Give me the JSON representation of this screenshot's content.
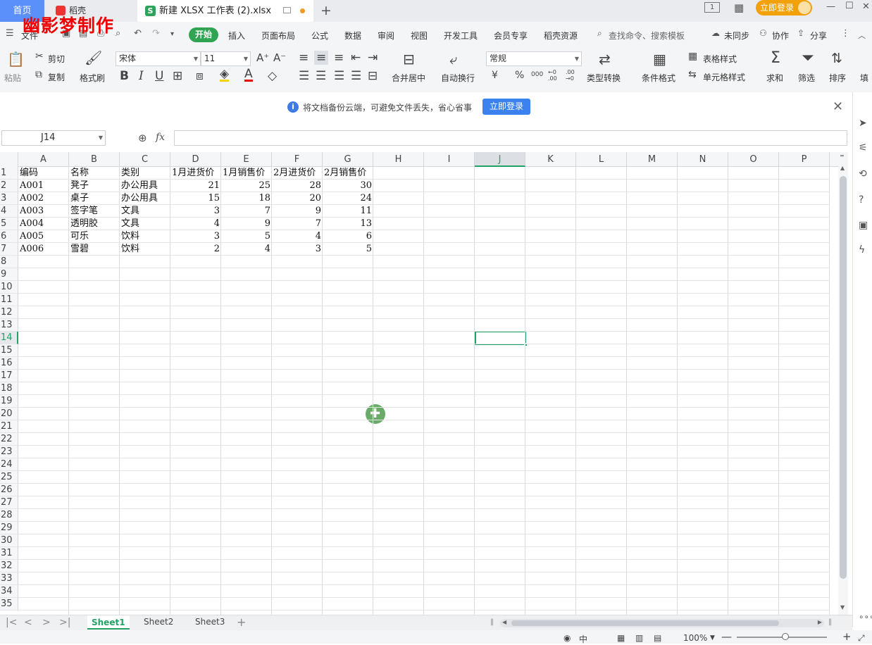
{
  "titlebar": {
    "home_tab": "首页",
    "daoke_tab": "稻壳",
    "file_tab": "新建 XLSX 工作表 (2).xlsx",
    "new_tab": "+",
    "layout_label": "1",
    "login": "立即登录",
    "minimize": "—",
    "maximize": "☐",
    "close": "✕"
  },
  "watermark": "幽影梦制作",
  "menu": {
    "file": "文件",
    "start": "开始",
    "items": [
      "插入",
      "页面布局",
      "公式",
      "数据",
      "审阅",
      "视图",
      "开发工具",
      "会员专享",
      "稻壳资源"
    ],
    "search": "查找命令、搜索模板",
    "sync": "未同步",
    "collab": "协作",
    "share": "分享"
  },
  "ribbon": {
    "paste": "粘贴",
    "cut": "剪切",
    "copy": "复制",
    "format_painter": "格式刷",
    "font_name": "宋体",
    "font_size": "11",
    "merge_center": "合并居中",
    "auto_wrap": "自动换行",
    "number_format": "常规",
    "type_convert": "类型转换",
    "conditional_format": "条件格式",
    "table_style": "表格样式",
    "cell_style": "单元格样式",
    "sum": "求和",
    "filter": "筛选",
    "sort": "排序",
    "fill": "填",
    "bold": "B",
    "italic": "I",
    "underline": "U",
    "currency": "¥",
    "percent": "%",
    "thousands": "000",
    "dec_inc": "←0 .00",
    "dec_dec": ".00 →0"
  },
  "notice": {
    "text": "将文档备份云端，可避免文件丢失，省心省事",
    "button": "立即登录"
  },
  "formula": {
    "name_box": "J14",
    "fx": "fx"
  },
  "columns": [
    "A",
    "B",
    "C",
    "D",
    "E",
    "F",
    "G",
    "H",
    "I",
    "J",
    "K",
    "L",
    "M",
    "N",
    "O",
    "P"
  ],
  "rows": [
    "1",
    "2",
    "3",
    "4",
    "5",
    "6",
    "7",
    "8",
    "9",
    "10",
    "11",
    "12",
    "13",
    "14",
    "15",
    "16",
    "17",
    "18",
    "19",
    "20",
    "21",
    "22",
    "23",
    "24",
    "25",
    "26",
    "27",
    "28",
    "29",
    "30",
    "31",
    "32",
    "33",
    "34",
    "35"
  ],
  "table": {
    "headers": [
      "编码",
      "名称",
      "类别",
      "1月进货价",
      "1月销售价",
      "2月进货价",
      "2月销售价"
    ],
    "rows": [
      [
        "A001",
        "凳子",
        "办公用具",
        "21",
        "25",
        "28",
        "30"
      ],
      [
        "A002",
        "桌子",
        "办公用具",
        "15",
        "18",
        "20",
        "24"
      ],
      [
        "A003",
        "签字笔",
        "文具",
        "3",
        "7",
        "9",
        "11"
      ],
      [
        "A004",
        "透明胶",
        "文具",
        "4",
        "9",
        "7",
        "13"
      ],
      [
        "A005",
        "可乐",
        "饮料",
        "3",
        "5",
        "4",
        "6"
      ],
      [
        "A006",
        "雪碧",
        "饮料",
        "2",
        "4",
        "3",
        "5"
      ]
    ]
  },
  "sheets": [
    "Sheet1",
    "Sheet2",
    "Sheet3"
  ],
  "status": {
    "zoom": "100%",
    "lang": "中"
  },
  "colors": {
    "accent": "#21a366",
    "home_tab": "#5b8ff9",
    "login": "#f2a10a",
    "start": "#31a453"
  }
}
